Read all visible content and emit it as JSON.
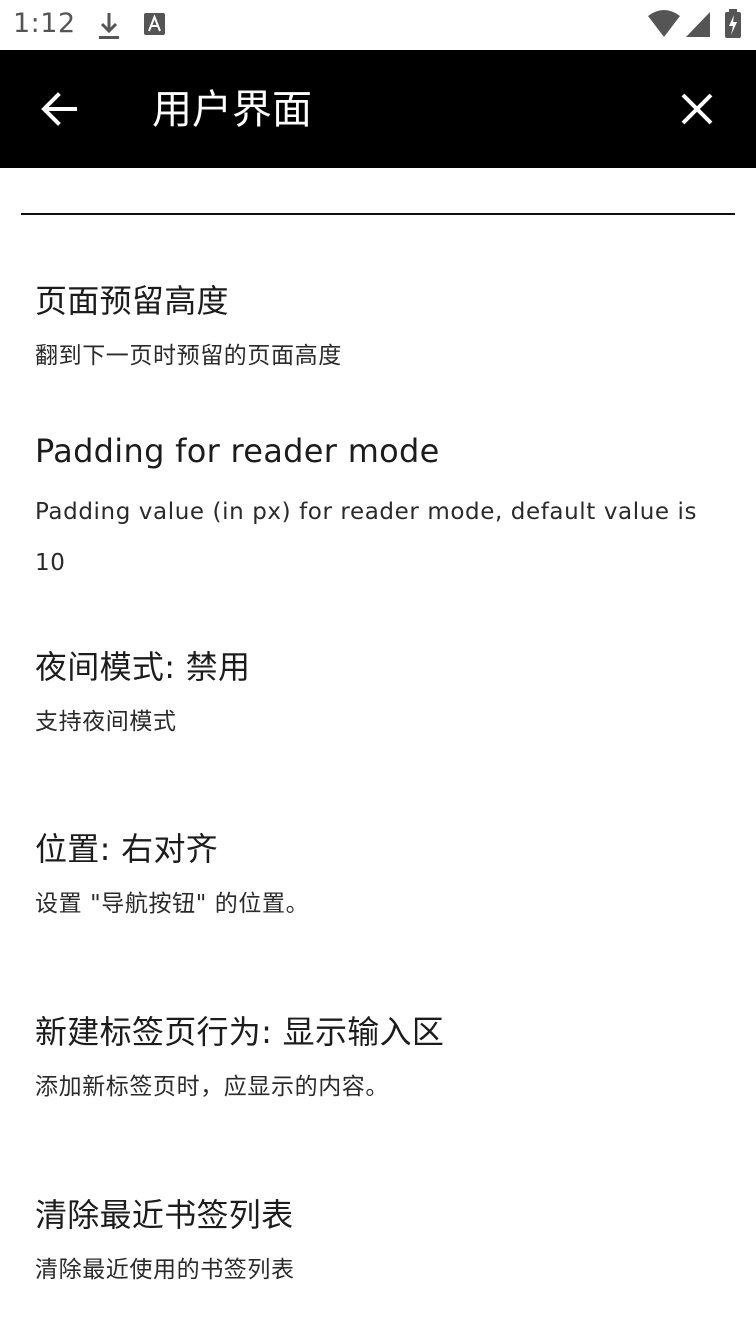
{
  "status_bar": {
    "time": "1:12",
    "icons": [
      "download-icon",
      "a-letter-icon",
      "wifi-icon",
      "signal-icon",
      "battery-charging-icon"
    ]
  },
  "app_bar": {
    "back_icon": "arrow-left-icon",
    "title": "用户界面",
    "close_icon": "close-icon"
  },
  "preferences": [
    {
      "title": "页面预留高度",
      "summary": "翻到下一页时预留的页面高度"
    },
    {
      "title": "Padding for reader mode",
      "summary": "Padding value (in px) for reader mode, default value is 10"
    },
    {
      "title": "夜间模式: 禁用",
      "summary": "支持夜间模式"
    },
    {
      "title": "位置: 右对齐",
      "summary": "设置 \"导航按钮\" 的位置。"
    },
    {
      "title": "新建标签页行为: 显示输入区",
      "summary": "添加新标签页时，应显示的内容。"
    },
    {
      "title": "清除最近书签列表",
      "summary": "清除最近使用的书签列表"
    }
  ],
  "colors": {
    "app_bar_bg": "#000000",
    "app_bar_text": "#ffffff",
    "background": "#ffffff",
    "text": "#1c1c1c",
    "status_icons": "#555555"
  }
}
